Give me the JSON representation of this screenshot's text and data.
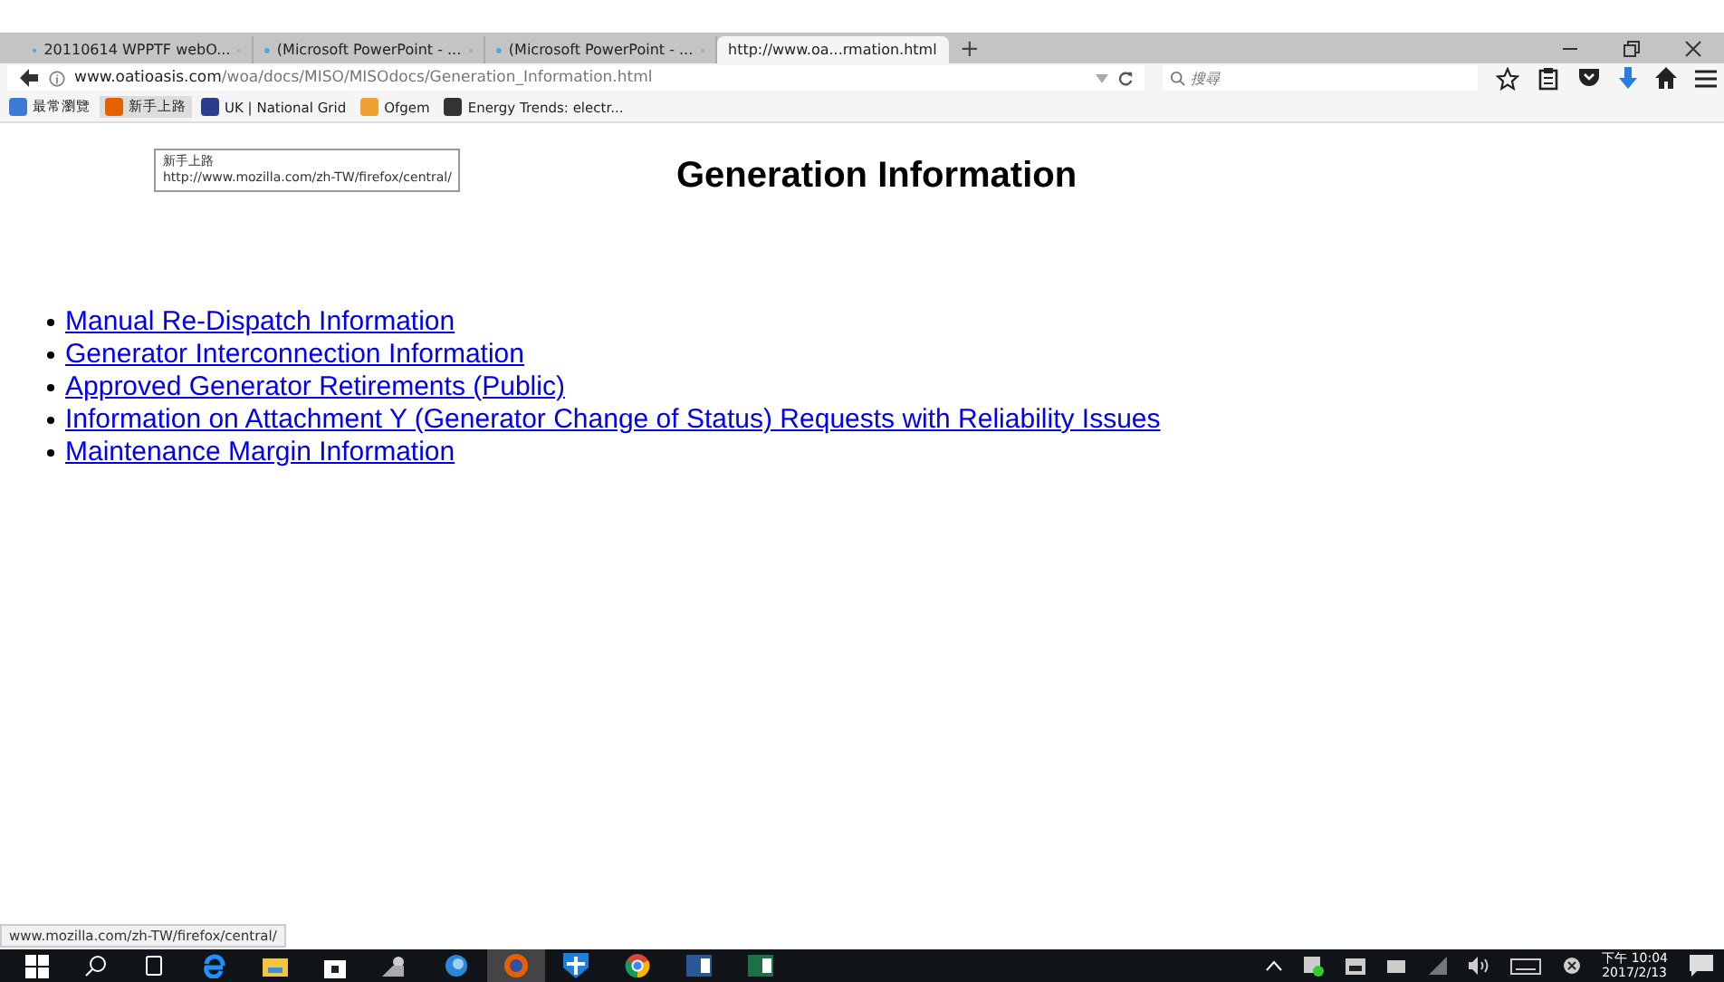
{
  "tabs": [
    {
      "title": "20110614 WPPTF webO...",
      "selected": false
    },
    {
      "title": "(Microsoft PowerPoint - ...",
      "selected": false
    },
    {
      "title": "(Microsoft PowerPoint - ...",
      "selected": false
    },
    {
      "title": "http://www.oa...rmation.html",
      "selected": true
    }
  ],
  "new_tab": "+",
  "address": {
    "domain": "www.oatioasis.com",
    "path": "/woa/docs/MISO/MISOdocs/Generation_Information.html"
  },
  "search": {
    "placeholder": "搜尋"
  },
  "bookmarks": [
    {
      "label": "最常瀏覽",
      "selected": false
    },
    {
      "label": "新手上路",
      "selected": true
    },
    {
      "label": "UK | National Grid",
      "selected": false
    },
    {
      "label": "Ofgem",
      "selected": false
    },
    {
      "label": "Energy Trends: electr...",
      "selected": false
    }
  ],
  "tooltip": {
    "title": "新手上路",
    "url": "http://www.mozilla.com/zh-TW/firefox/central/"
  },
  "page": {
    "heading": "Generation Information",
    "links": [
      "Manual Re-Dispatch Information",
      "Generator Interconnection Information",
      "Approved Generator Retirements (Public)",
      "Information on Attachment Y (Generator Change of Status) Requests with Reliability Issues",
      "Maintenance Margin Information"
    ]
  },
  "status_url": "www.mozilla.com/zh-TW/firefox/central/",
  "taskbar": {
    "time": "下午 10:04",
    "date": "2017/2/13"
  }
}
